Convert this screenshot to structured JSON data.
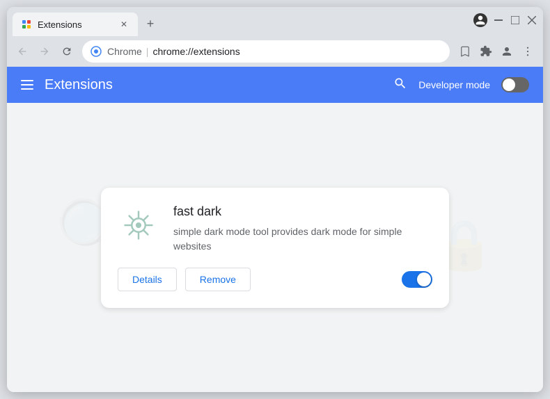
{
  "window": {
    "title": "Extensions",
    "minimize_label": "minimize",
    "maximize_label": "maximize",
    "close_label": "close"
  },
  "tab": {
    "label": "Extensions",
    "favicon": "★",
    "new_tab_icon": "+"
  },
  "address_bar": {
    "brand": "Chrome",
    "separator": "|",
    "url": "chrome://extensions"
  },
  "extensions_header": {
    "title": "Extensions",
    "search_icon": "🔍",
    "developer_mode_label": "Developer mode"
  },
  "extension": {
    "name": "fast dark",
    "description": "simple dark mode tool provides dark mode for simple websites",
    "details_button": "Details",
    "remove_button": "Remove",
    "enabled": true
  }
}
